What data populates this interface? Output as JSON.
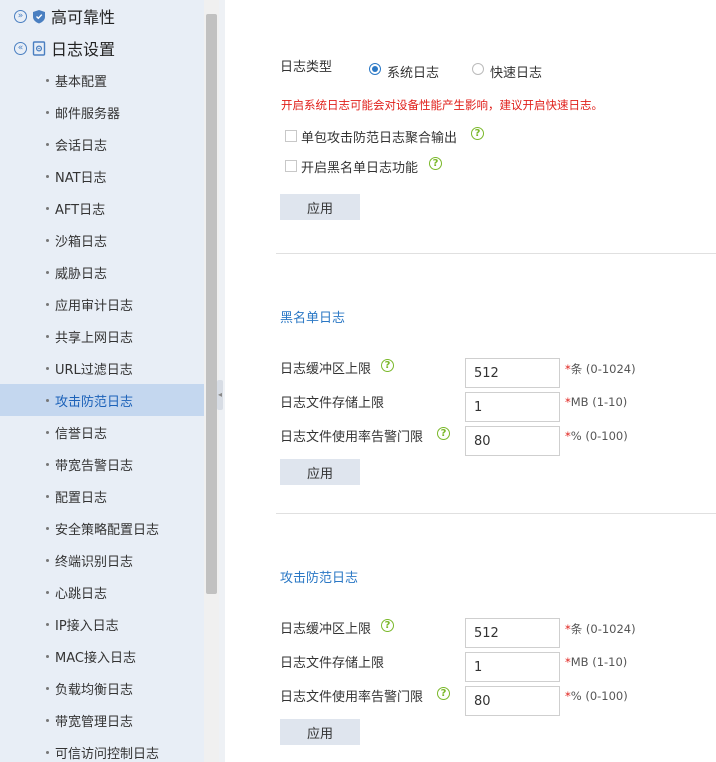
{
  "sidebar": {
    "groups": [
      {
        "label": "高可靠性",
        "toggle": "»"
      },
      {
        "label": "日志设置",
        "toggle": "«"
      }
    ],
    "items": [
      {
        "label": "基本配置"
      },
      {
        "label": "邮件服务器"
      },
      {
        "label": "会话日志"
      },
      {
        "label": "NAT日志"
      },
      {
        "label": "AFT日志"
      },
      {
        "label": "沙箱日志"
      },
      {
        "label": "威胁日志"
      },
      {
        "label": "应用审计日志"
      },
      {
        "label": "共享上网日志"
      },
      {
        "label": "URL过滤日志"
      },
      {
        "label": "攻击防范日志",
        "active": true
      },
      {
        "label": "信誉日志"
      },
      {
        "label": "带宽告警日志"
      },
      {
        "label": "配置日志"
      },
      {
        "label": "安全策略配置日志"
      },
      {
        "label": "终端识别日志"
      },
      {
        "label": "心跳日志"
      },
      {
        "label": "IP接入日志"
      },
      {
        "label": "MAC接入日志"
      },
      {
        "label": "负载均衡日志"
      },
      {
        "label": "带宽管理日志"
      },
      {
        "label": "可信访问控制日志"
      }
    ]
  },
  "log_type": {
    "label": "日志类型",
    "options": [
      {
        "label": "系统日志",
        "checked": true
      },
      {
        "label": "快速日志",
        "checked": false
      }
    ],
    "warning": "开启系统日志可能会对设备性能产生影响，建议开启快速日志。",
    "checkboxes": [
      {
        "label": "单包攻击防范日志聚合输出"
      },
      {
        "label": "开启黑名单日志功能"
      }
    ],
    "apply_label": "应用"
  },
  "blacklist": {
    "title": "黑名单日志",
    "buffer_label": "日志缓冲区上限",
    "buffer_value": "512",
    "buffer_hint_req": "*",
    "buffer_hint": "条 (0-1024)",
    "storage_label": "日志文件存储上限",
    "storage_value": "1",
    "storage_hint_req": "*",
    "storage_hint": "MB (1-10)",
    "alarm_label": "日志文件使用率告警门限",
    "alarm_value": "80",
    "alarm_hint_req": "*",
    "alarm_hint": "% (0-100)",
    "apply_label": "应用"
  },
  "attack": {
    "title": "攻击防范日志",
    "buffer_label": "日志缓冲区上限",
    "buffer_value": "512",
    "buffer_hint_req": "*",
    "buffer_hint": "条 (0-1024)",
    "storage_label": "日志文件存储上限",
    "storage_value": "1",
    "storage_hint_req": "*",
    "storage_hint": "MB (1-10)",
    "alarm_label": "日志文件使用率告警门限",
    "alarm_value": "80",
    "alarm_hint_req": "*",
    "alarm_hint": "% (0-100)",
    "apply_label": "应用"
  },
  "icons": {
    "help": "?",
    "collapse": "◂"
  },
  "colors": {
    "accent": "#2b78c5",
    "warning": "#e0201b",
    "help": "#7ab82a",
    "sidebar_bg": "#e8eef6",
    "active_bg": "#c4d7ef"
  }
}
